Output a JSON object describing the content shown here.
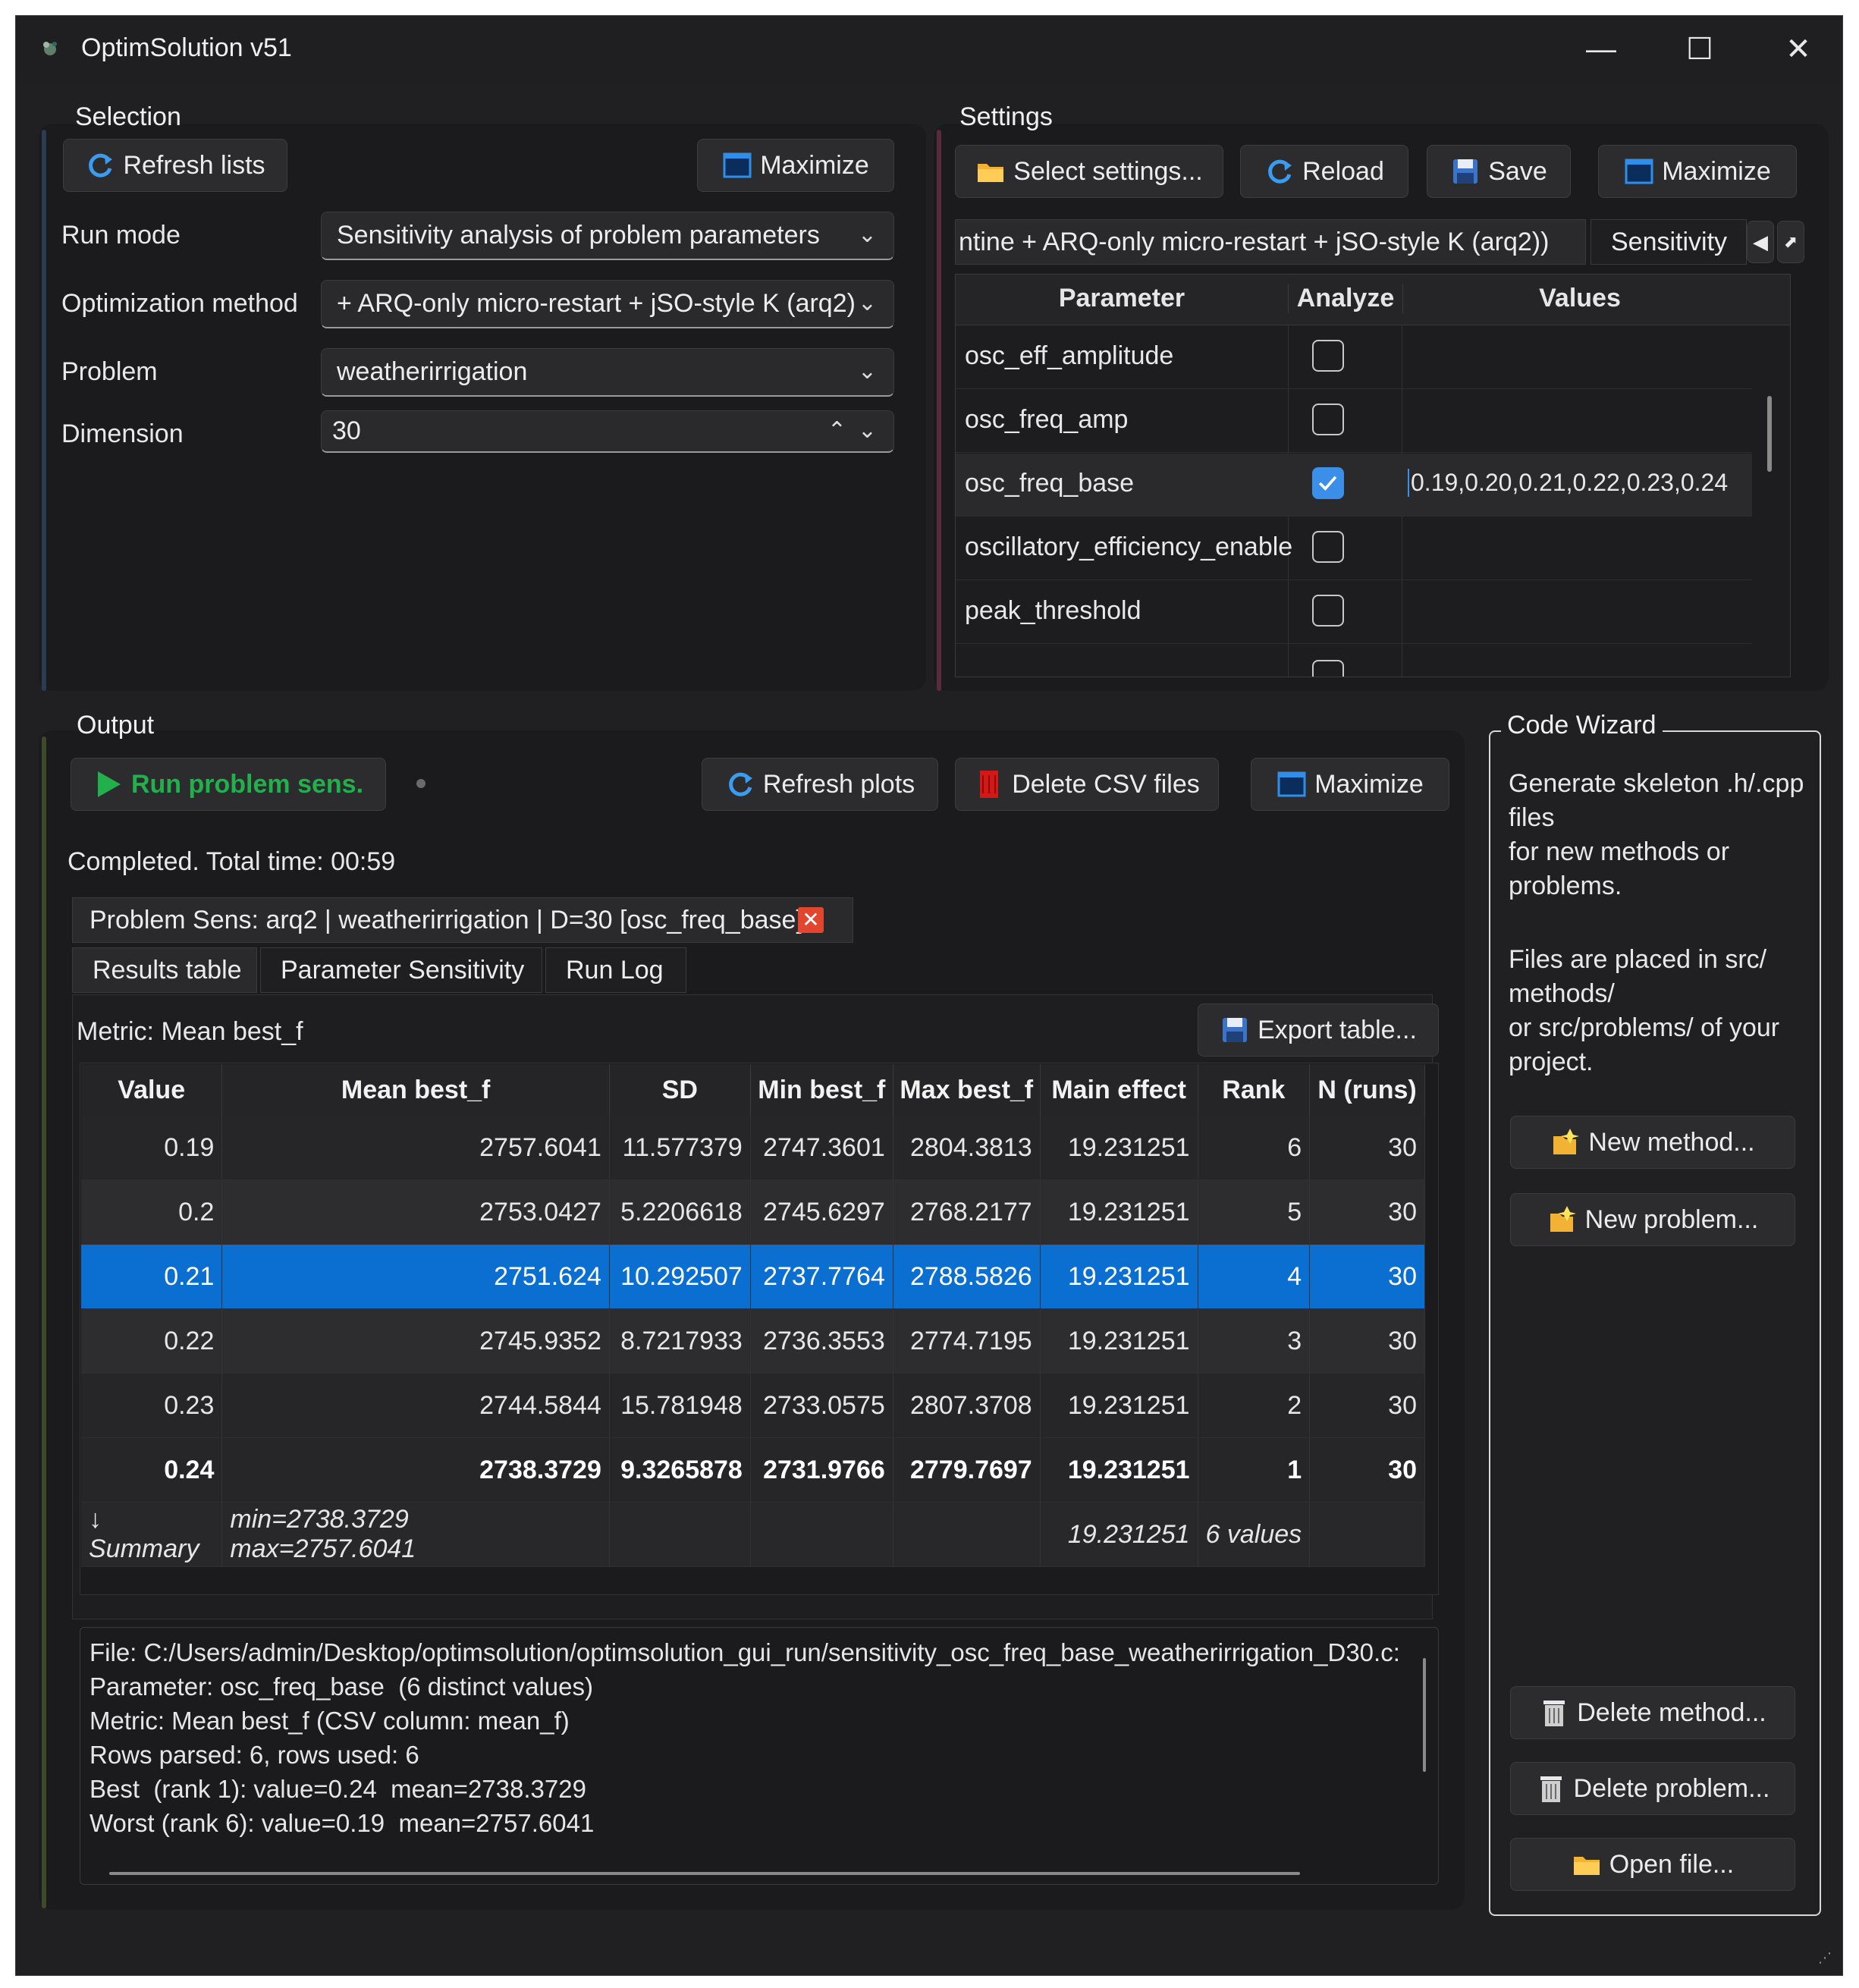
{
  "window": {
    "title": "OptimSolution v51",
    "controls": {
      "minimize": "—",
      "maximize": "☐",
      "close": "✕"
    }
  },
  "selection": {
    "title": "Selection",
    "refresh_label": "Refresh lists",
    "maximize_label": "Maximize",
    "fields": [
      {
        "label": "Run mode",
        "value": "Sensitivity analysis of problem parameters"
      },
      {
        "label": "Optimization method",
        "value": "+ ARQ-only micro-restart + jSO-style K (arq2)"
      },
      {
        "label": "Problem",
        "value": "weatherirrigation"
      },
      {
        "label": "Dimension",
        "value": "30"
      }
    ]
  },
  "settings": {
    "title": "Settings",
    "select_label": "Select settings...",
    "reload_label": "Reload",
    "save_label": "Save",
    "maximize_label": "Maximize",
    "method_tab": "ntine + ARQ-only micro-restart + jSO-style K (arq2))",
    "sens_tab": "Sensitivity",
    "columns": [
      "Parameter",
      "Analyze",
      "Values"
    ],
    "rows": [
      {
        "param": "osc_eff_amplitude",
        "checked": false,
        "values": ""
      },
      {
        "param": "osc_freq_amp",
        "checked": false,
        "values": ""
      },
      {
        "param": "osc_freq_base",
        "checked": true,
        "values": "0.19,0.20,0.21,0.22,0.23,0.24"
      },
      {
        "param": "oscillatory_efficiency_enable",
        "checked": false,
        "values": ""
      },
      {
        "param": "peak_threshold",
        "checked": false,
        "values": ""
      }
    ]
  },
  "output": {
    "title": "Output",
    "run_label": "Run problem sens.",
    "refresh_plots_label": "Refresh plots",
    "delete_csv_label": "Delete CSV files",
    "maximize_label": "Maximize",
    "status": "Completed. Total time: 00:59",
    "doc_tab": "Problem Sens: arq2 | weatherirrigation | D=30 [osc_freq_base]",
    "tabs": [
      "Results table",
      "Parameter Sensitivity",
      "Run Log"
    ],
    "metric": "Metric: Mean best_f",
    "export_label": "Export table...",
    "table": {
      "headers": [
        "Value",
        "Mean best_f",
        "SD",
        "Min best_f",
        "Max best_f",
        "Main effect",
        "Rank",
        "N (runs)"
      ],
      "rows": [
        [
          "0.19",
          "2757.6041",
          "11.577379",
          "2747.3601",
          "2804.3813",
          "19.231251",
          "6",
          "30"
        ],
        [
          "0.2",
          "2753.0427",
          "5.2206618",
          "2745.6297",
          "2768.2177",
          "19.231251",
          "5",
          "30"
        ],
        [
          "0.21",
          "2751.624",
          "10.292507",
          "2737.7764",
          "2788.5826",
          "19.231251",
          "4",
          "30"
        ],
        [
          "0.22",
          "2745.9352",
          "8.7217933",
          "2736.3553",
          "2774.7195",
          "19.231251",
          "3",
          "30"
        ],
        [
          "0.23",
          "2744.5844",
          "15.781948",
          "2733.0575",
          "2807.3708",
          "19.231251",
          "2",
          "30"
        ],
        [
          "0.24",
          "2738.3729",
          "9.3265878",
          "2731.9766",
          "2779.7697",
          "19.231251",
          "1",
          "30"
        ]
      ],
      "summary": [
        "↓ Summary",
        "min=2738.3729  max=2757.6041",
        "",
        "",
        "",
        "19.231251",
        "6 values",
        ""
      ]
    },
    "log_lines": [
      "File: C:/Users/admin/Desktop/optimsolution/optimsolution_gui_run/sensitivity_osc_freq_base_weatherirrigation_D30.c:",
      "Parameter: osc_freq_base  (6 distinct values)",
      "Metric: Mean best_f (CSV column: mean_f)",
      "Rows parsed: 6, rows used: 6",
      "Best  (rank 1): value=0.24  mean=2738.3729",
      "Worst (rank 6): value=0.19  mean=2757.6041"
    ]
  },
  "wizard": {
    "title": "Code Wizard",
    "desc1": [
      "Generate skeleton .h/.cpp",
      "files",
      "for new methods or",
      "problems."
    ],
    "desc2": [
      "Files are placed in src/",
      "methods/",
      "or src/problems/ of your",
      "project."
    ],
    "new_method_label": "New method...",
    "new_problem_label": "New problem...",
    "delete_method_label": "Delete method...",
    "delete_problem_label": "Delete problem...",
    "open_file_label": "Open file..."
  },
  "colors": {
    "accent_blue": "#0a6fd1",
    "run_green": "#21b04b",
    "checkbox_blue": "#3b8fe8",
    "selection_accent": "#2a3b52",
    "settings_accent": "#5a2a3e",
    "output_accent": "#3e4a2a"
  }
}
